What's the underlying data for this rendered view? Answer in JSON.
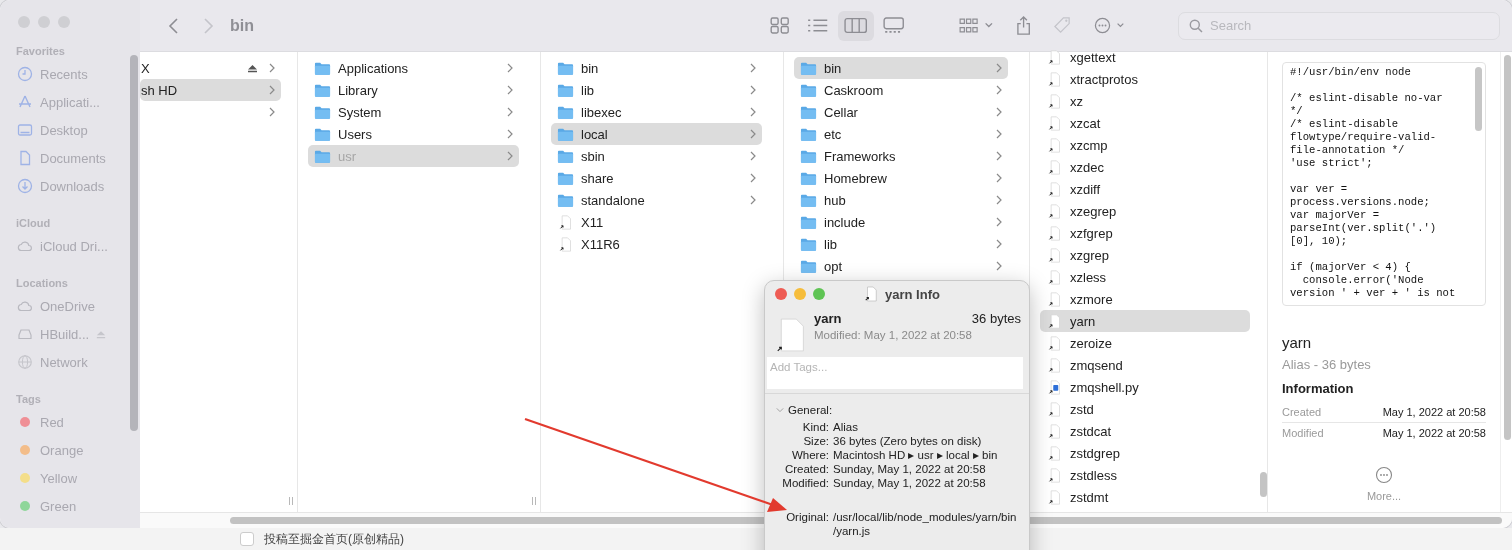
{
  "window": {
    "title": "bin"
  },
  "toolbar": {
    "buttons": [
      {
        "kind": "back",
        "disabled": false
      },
      {
        "kind": "forward",
        "disabled": true
      }
    ],
    "view_modes": [
      {
        "kind": "icons",
        "selected": false
      },
      {
        "kind": "list",
        "selected": false
      },
      {
        "kind": "columns",
        "selected": true
      },
      {
        "kind": "gallery",
        "selected": false
      }
    ],
    "actions": [
      {
        "kind": "group",
        "disabled": false
      },
      {
        "kind": "share",
        "disabled": false
      },
      {
        "kind": "tag",
        "disabled": true
      },
      {
        "kind": "more",
        "disabled": false
      }
    ],
    "search": {
      "placeholder": "Search"
    }
  },
  "sidebar": {
    "sections": [
      {
        "heading": "Favorites",
        "items": [
          {
            "label": "Recents",
            "kind": "clock"
          },
          {
            "label": "Applicati...",
            "kind": "apps"
          },
          {
            "label": "Desktop",
            "kind": "desktop"
          },
          {
            "label": "Documents",
            "kind": "document"
          },
          {
            "label": "Downloads",
            "kind": "download"
          }
        ]
      },
      {
        "heading": "iCloud",
        "items": [
          {
            "label": "iCloud Dri...",
            "kind": "cloud"
          }
        ]
      },
      {
        "heading": "Locations",
        "items": [
          {
            "label": "OneDrive",
            "kind": "cloud"
          },
          {
            "label": "HBuild...",
            "kind": "drive",
            "ejectable": true
          },
          {
            "label": "Network",
            "kind": "globe"
          }
        ]
      },
      {
        "heading": "Tags",
        "items": [
          {
            "label": "Red",
            "kind": "tag",
            "color": "#ef8f96"
          },
          {
            "label": "Orange",
            "kind": "tag",
            "color": "#f3bd8a"
          },
          {
            "label": "Yellow",
            "kind": "tag",
            "color": "#f4de8a"
          },
          {
            "label": "Green",
            "kind": "tag",
            "color": "#8fd69a"
          }
        ]
      }
    ]
  },
  "columns": [
    {
      "items": [
        {
          "name": "X",
          "kind": "clipped_volume",
          "selected": false
        },
        {
          "name": "sh HD",
          "kind": "clipped_folder",
          "selected": true
        },
        {
          "kind": "clipped_folder",
          "selected": false
        }
      ]
    },
    {
      "items": [
        {
          "name": "Applications",
          "kind": "folder",
          "selected": false
        },
        {
          "name": "Library",
          "kind": "folder",
          "selected": false
        },
        {
          "name": "System",
          "kind": "folder",
          "selected": false
        },
        {
          "name": "Users",
          "kind": "folder",
          "selected": false
        },
        {
          "name": "usr",
          "kind": "folder",
          "selected": true
        }
      ]
    },
    {
      "items": [
        {
          "name": "bin",
          "kind": "folder",
          "selected": false
        },
        {
          "name": "lib",
          "kind": "folder",
          "selected": false
        },
        {
          "name": "libexec",
          "kind": "folder",
          "selected": false
        },
        {
          "name": "local",
          "kind": "folder",
          "selected": true
        },
        {
          "name": "sbin",
          "kind": "folder",
          "selected": false
        },
        {
          "name": "share",
          "kind": "folder",
          "selected": false
        },
        {
          "name": "standalone",
          "kind": "folder",
          "selected": false
        },
        {
          "name": "X11",
          "kind": "alias",
          "selected": false
        },
        {
          "name": "X11R6",
          "kind": "alias",
          "selected": false
        }
      ]
    },
    {
      "items": [
        {
          "name": "bin",
          "kind": "folder",
          "selected": true
        },
        {
          "name": "Caskroom",
          "kind": "folder",
          "selected": false
        },
        {
          "name": "Cellar",
          "kind": "folder",
          "selected": false
        },
        {
          "name": "etc",
          "kind": "folder",
          "selected": false
        },
        {
          "name": "Frameworks",
          "kind": "folder",
          "selected": false
        },
        {
          "name": "Homebrew",
          "kind": "folder",
          "selected": false
        },
        {
          "name": "hub",
          "kind": "folder",
          "selected": false
        },
        {
          "name": "include",
          "kind": "folder",
          "selected": false
        },
        {
          "name": "lib",
          "kind": "folder",
          "selected": false
        },
        {
          "name": "opt",
          "kind": "folder",
          "selected": false
        }
      ]
    },
    {
      "items": [
        {
          "name": "xgettext",
          "kind": "alias",
          "selected": false
        },
        {
          "name": "xtractprotos",
          "kind": "alias",
          "selected": false
        },
        {
          "name": "xz",
          "kind": "alias",
          "selected": false
        },
        {
          "name": "xzcat",
          "kind": "alias",
          "selected": false
        },
        {
          "name": "xzcmp",
          "kind": "alias",
          "selected": false
        },
        {
          "name": "xzdec",
          "kind": "alias",
          "selected": false
        },
        {
          "name": "xzdiff",
          "kind": "alias",
          "selected": false
        },
        {
          "name": "xzegrep",
          "kind": "alias",
          "selected": false
        },
        {
          "name": "xzfgrep",
          "kind": "alias",
          "selected": false
        },
        {
          "name": "xzgrep",
          "kind": "alias",
          "selected": false
        },
        {
          "name": "xzless",
          "kind": "alias",
          "selected": false
        },
        {
          "name": "xzmore",
          "kind": "alias",
          "selected": false
        },
        {
          "name": "yarn",
          "kind": "alias",
          "selected": true
        },
        {
          "name": "zeroize",
          "kind": "alias",
          "selected": false
        },
        {
          "name": "zmqsend",
          "kind": "alias",
          "selected": false
        },
        {
          "name": "zmqshell.py",
          "kind": "script",
          "selected": false
        },
        {
          "name": "zstd",
          "kind": "alias",
          "selected": false
        },
        {
          "name": "zstdcat",
          "kind": "alias",
          "selected": false
        },
        {
          "name": "zstdgrep",
          "kind": "alias",
          "selected": false
        },
        {
          "name": "zstdless",
          "kind": "alias",
          "selected": false
        },
        {
          "name": "zstdmt",
          "kind": "alias",
          "selected": false
        }
      ]
    }
  ],
  "preview": {
    "code": "#!/usr/bin/env node\n\n/* eslint-disable no-var\n*/\n/* eslint-disable\nflowtype/require-valid-\nfile-annotation */\n'use strict';\n\nvar ver =\nprocess.versions.node;\nvar majorVer =\nparseInt(ver.split('.')\n[0], 10);\n\nif (majorVer < 4) {\n  console.error('Node\nversion ' + ver + ' is not",
    "name": "yarn",
    "subtitle": "Alias - 36 bytes",
    "info_heading": "Information",
    "rows": [
      {
        "label": "Created",
        "value": "May 1, 2022 at 20:58"
      },
      {
        "label": "Modified",
        "value": "May 1, 2022 at 20:58"
      }
    ],
    "more": "More..."
  },
  "info_window": {
    "title": "yarn Info",
    "name": "yarn",
    "size": "36 bytes",
    "modified": "Modified: May 1, 2022 at 20:58",
    "tags_placeholder": "Add Tags...",
    "section": "General:",
    "expanded": true,
    "rows": [
      {
        "label": "Kind:",
        "value": "Alias"
      },
      {
        "label": "Size:",
        "value": "36 bytes (Zero bytes on disk)"
      },
      {
        "label": "Where:",
        "value": "Macintosh HD ▸ usr ▸ local ▸ bin"
      },
      {
        "label": "Created:",
        "value": "Sunday, May 1, 2022 at 20:58"
      },
      {
        "label": "Modified:",
        "value": "Sunday, May 1, 2022 at 20:58"
      },
      {
        "label": "Original:",
        "value": "/usr/local/lib/node_modules/yarn/bin/yarn.js",
        "gap": true
      }
    ]
  },
  "background_page": {
    "checkbox": {
      "checked": false
    },
    "label": "投稿至掘金首页(原创精品)"
  }
}
